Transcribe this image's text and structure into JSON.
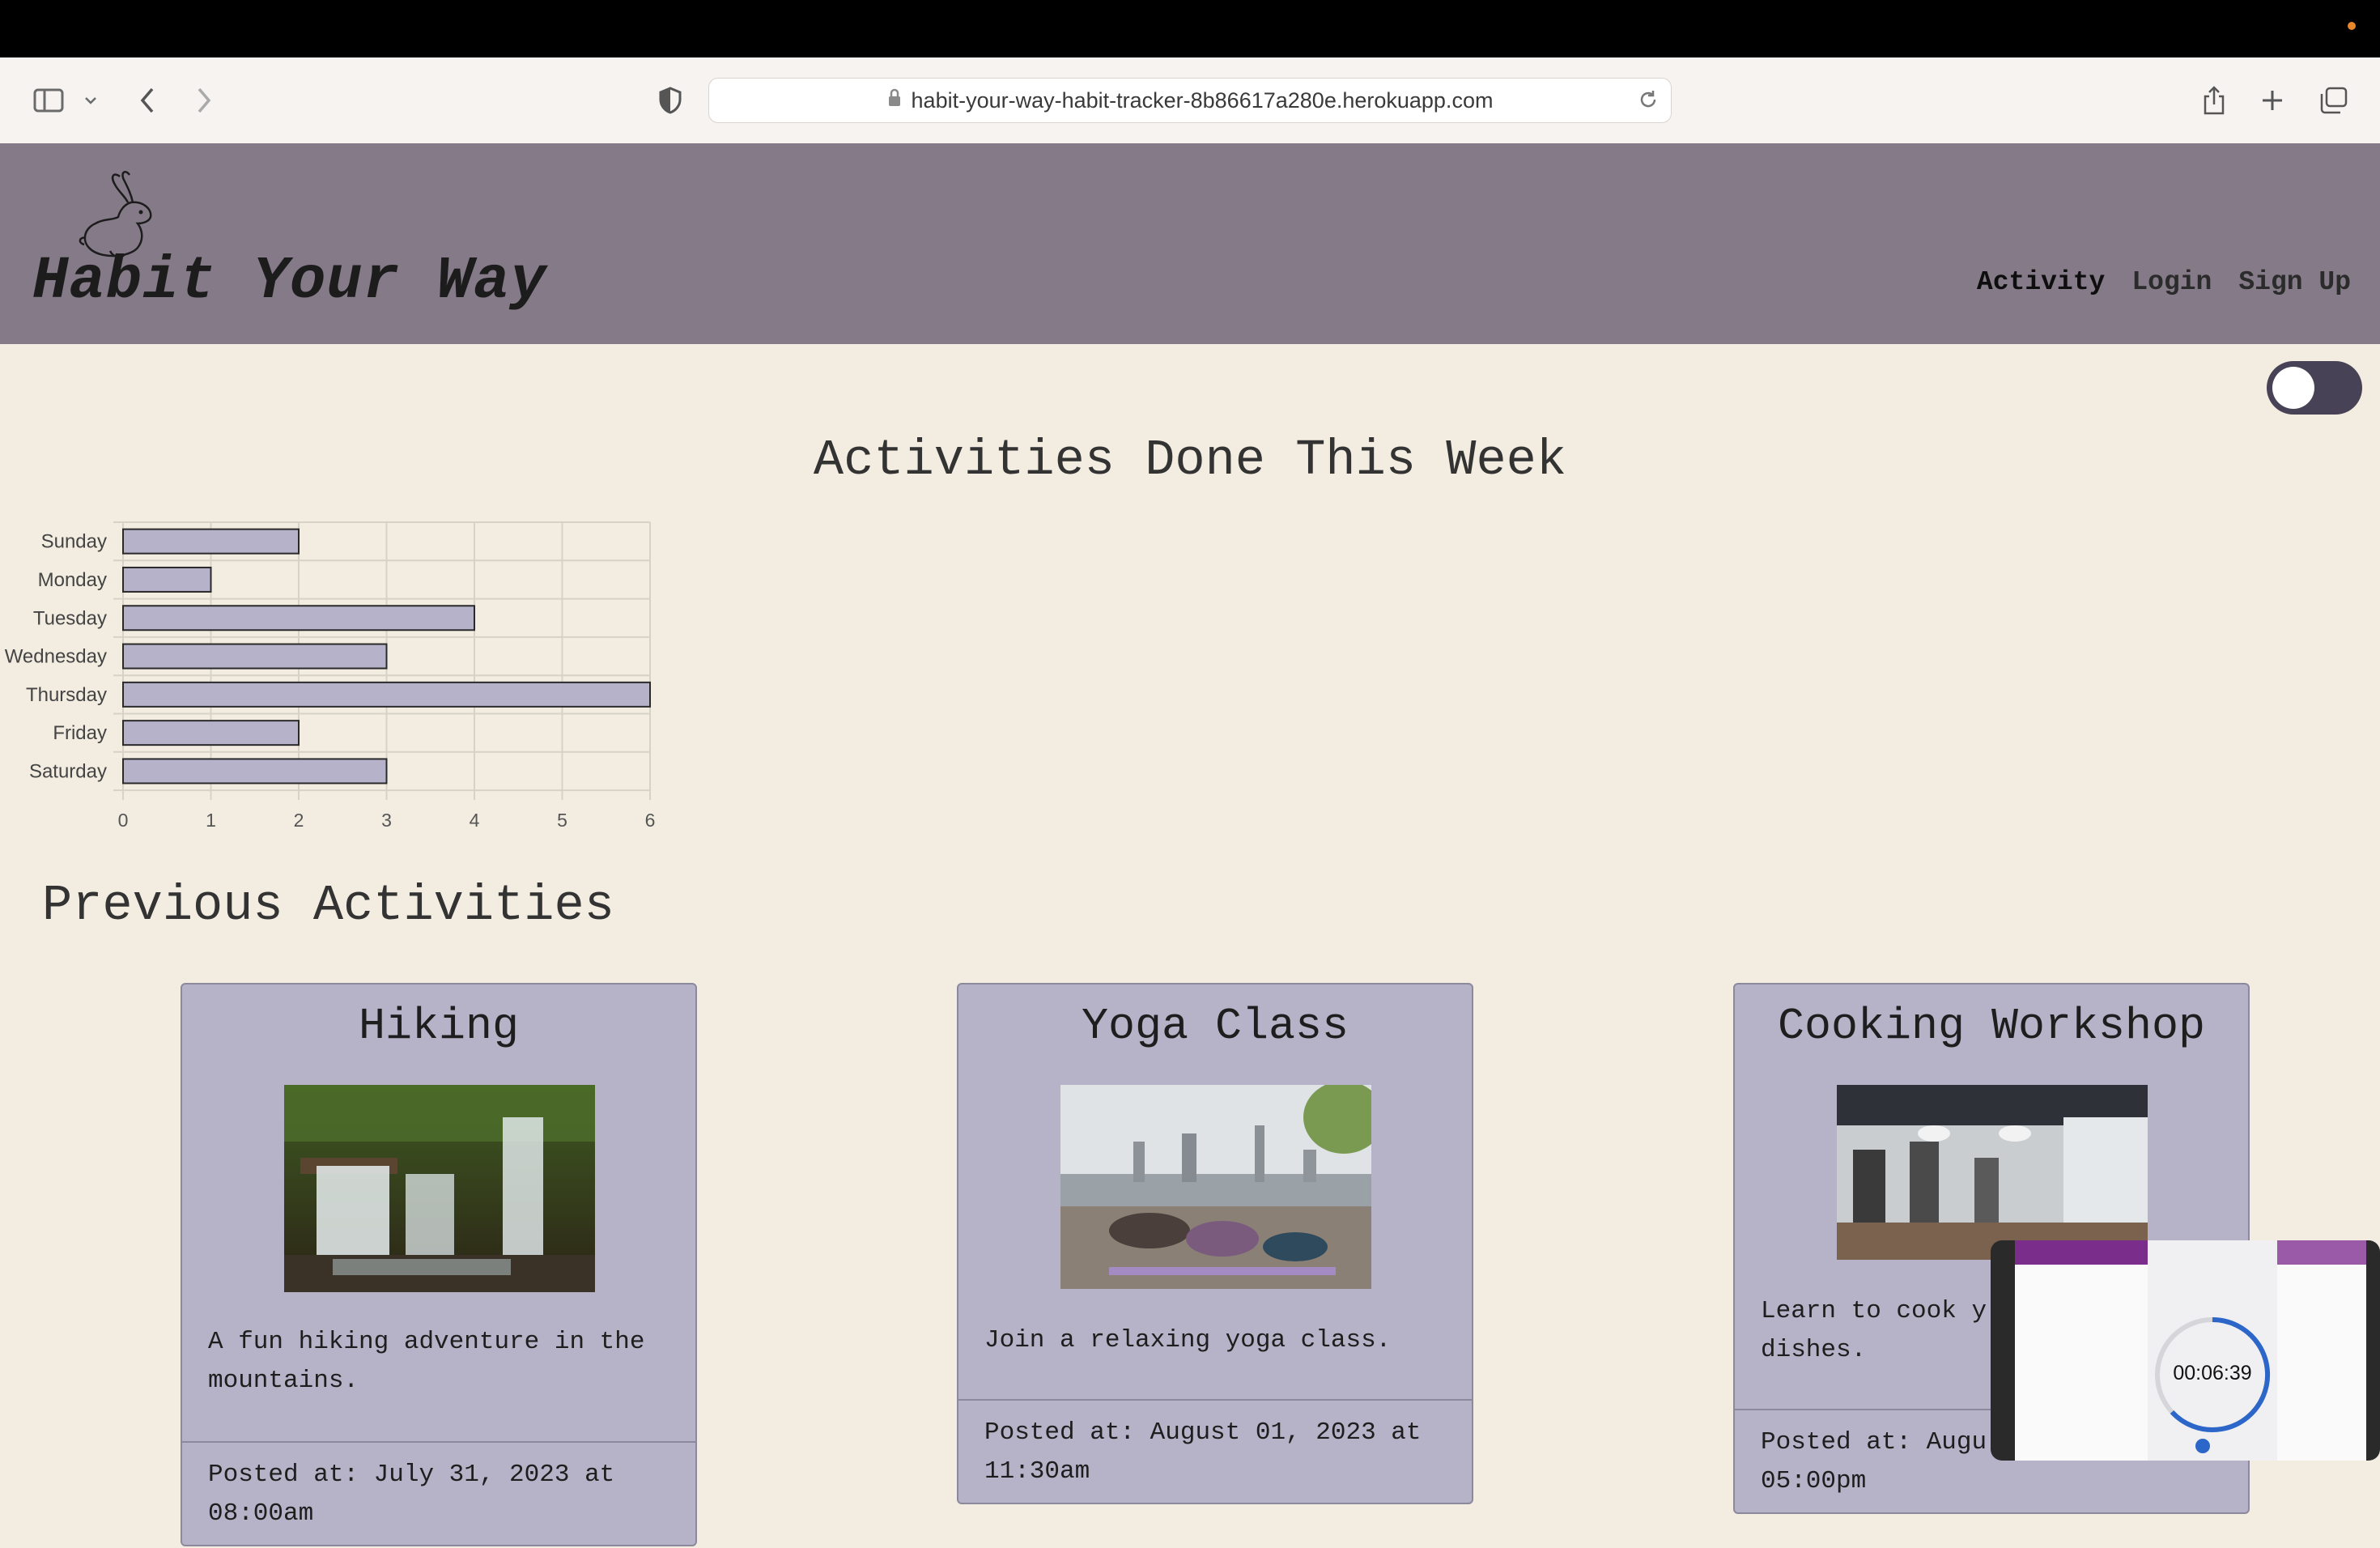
{
  "browser": {
    "url": "habit-your-way-habit-tracker-8b86617a280e.herokuapp.com"
  },
  "header": {
    "brand": "Habit Your Way",
    "nav": [
      {
        "label": "Activity"
      },
      {
        "label": "Login"
      },
      {
        "label": "Sign Up"
      }
    ]
  },
  "theme_toggle": {
    "state": "off"
  },
  "chart_section": {
    "title": "Activities Done This Week"
  },
  "chart_data": {
    "type": "bar",
    "orientation": "horizontal",
    "categories": [
      "Sunday",
      "Monday",
      "Tuesday",
      "Wednesday",
      "Thursday",
      "Friday",
      "Saturday"
    ],
    "values": [
      2,
      1,
      4,
      3,
      6,
      2,
      3
    ],
    "xlim": [
      0,
      6
    ],
    "xticks": [
      "0",
      "1",
      "2",
      "3",
      "4",
      "5",
      "6"
    ],
    "grid": true,
    "colors": {
      "bar": "#b5b2c9",
      "border": "#2a2a2a"
    }
  },
  "previous": {
    "title": "Previous Activities",
    "cards": [
      {
        "title": "Hiking",
        "description": "A fun hiking adventure in the mountains.",
        "posted": "Posted at: July 31, 2023 at 08:00am"
      },
      {
        "title": "Yoga Class",
        "description": "Join a relaxing yoga class.",
        "posted": "Posted at: August 01, 2023 at 11:30am"
      },
      {
        "title": "Cooking Workshop",
        "description": "Learn to cook y",
        "description2": "dishes.",
        "posted": "Posted at: Augu",
        "posted2": "05:00pm"
      }
    ]
  },
  "pip": {
    "timer": "00:06:39"
  }
}
